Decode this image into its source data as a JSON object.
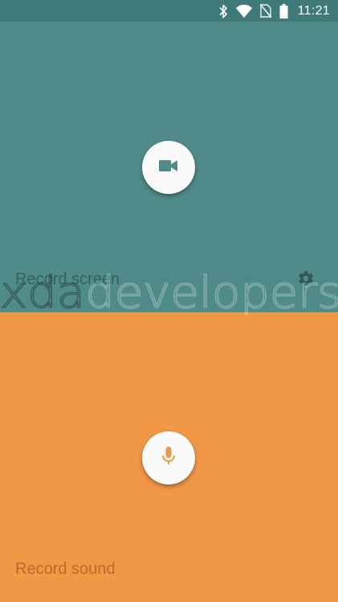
{
  "status_bar": {
    "time": "11:21",
    "icons": [
      "bluetooth-icon",
      "wifi-icon",
      "no-sim-icon",
      "battery-icon"
    ]
  },
  "record_screen": {
    "label": "Record screen",
    "button_icon": "videocam-icon",
    "settings_icon": "gear-icon",
    "background": "#508b8a"
  },
  "record_sound": {
    "label": "Record sound",
    "button_icon": "mic-icon",
    "background": "#f09845"
  },
  "watermark": {
    "text": "xdadevelopers"
  },
  "colors": {
    "accent_teal": "#3f7a79",
    "accent_orange": "#f09845"
  }
}
